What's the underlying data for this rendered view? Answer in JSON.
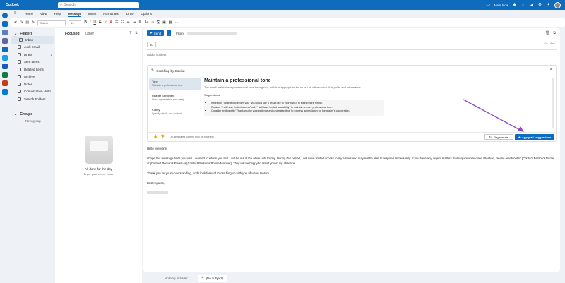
{
  "titlebar": {
    "app": "Outlook",
    "search_placeholder": "Search",
    "meet_now": "Meet Now"
  },
  "menu": [
    "Home",
    "View",
    "Help",
    "Message",
    "Insert",
    "Format text",
    "Draw",
    "Options"
  ],
  "toolbar": {
    "font": "Calibri",
    "size": "12"
  },
  "folders": {
    "header": "Folders",
    "items": [
      {
        "label": "Inbox",
        "count": ""
      },
      {
        "label": "Junk Email",
        "count": ""
      },
      {
        "label": "Drafts",
        "count": "1"
      },
      {
        "label": "Sent Items",
        "count": ""
      },
      {
        "label": "Deleted Items",
        "count": ""
      },
      {
        "label": "Archive",
        "count": ""
      },
      {
        "label": "Notes",
        "count": ""
      },
      {
        "label": "Conversation Histo...",
        "count": ""
      },
      {
        "label": "Search Folders",
        "count": ""
      }
    ],
    "groups_header": "Groups",
    "new_group": "New group"
  },
  "list": {
    "tab_focused": "Focused",
    "tab_other": "Other",
    "empty_title": "All done for the day",
    "empty_sub": "Enjoy your empty inbox"
  },
  "compose": {
    "send": "Send",
    "from_label": "From:",
    "to_label": "To",
    "cc": "Cc",
    "bcc": "Bcc",
    "subject_placeholder": "Add a subject",
    "copilot": {
      "header": "Coaching by Copilot",
      "tabs": [
        {
          "name": "Tone",
          "desc": "Maintain a professional tone"
        },
        {
          "name": "Reader Sentiment",
          "desc": "Show appreciation and clarity"
        },
        {
          "name": "Clarity",
          "desc": "Specify details and contacts"
        }
      ],
      "title": "Maintain a professional tone",
      "description": "The email maintains a professional tone throughout, which is appropriate for an out-of-office notice. It is polite and informative.",
      "suggestions_label": "Suggestions",
      "suggestions": [
        "Instead of \"I wanted to inform you,\" you could say \"I would like to inform you\" to sound more formal.",
        "Replace \"I will have limited access\" with \"I will have limited availability\" to maintain a more professional tone.",
        "Consider ending with \"Thank you for your patience and understanding\" to express appreciation for the reader's cooperation."
      ],
      "disclaimer": "AI-generated content may be incorrect",
      "regenerate": "Regenerate",
      "apply_all": "Apply all suggestions"
    },
    "body": [
      "Hello everyone,",
      "I hope this message finds you well. I wanted to inform you that I will be out of the office until Friday. During this period, I will have limited access to my emails and may not be able to respond immediately. If you have any urgent matters that require immediate attention, please reach out to [Contact Person's Name] at [Contact Person's Email] or [Contact Person's Phone Number]. They will be happy to assist you in my absence.",
      "Thank you for your understanding, and I look forward to catching up with you all when I return.",
      "Best regards,"
    ]
  },
  "status": {
    "nothing": "Nothing in folder",
    "draft": "(No subject)"
  },
  "colors": {
    "accent": "#0f6cbd",
    "arrow": "#8b4bc8"
  }
}
